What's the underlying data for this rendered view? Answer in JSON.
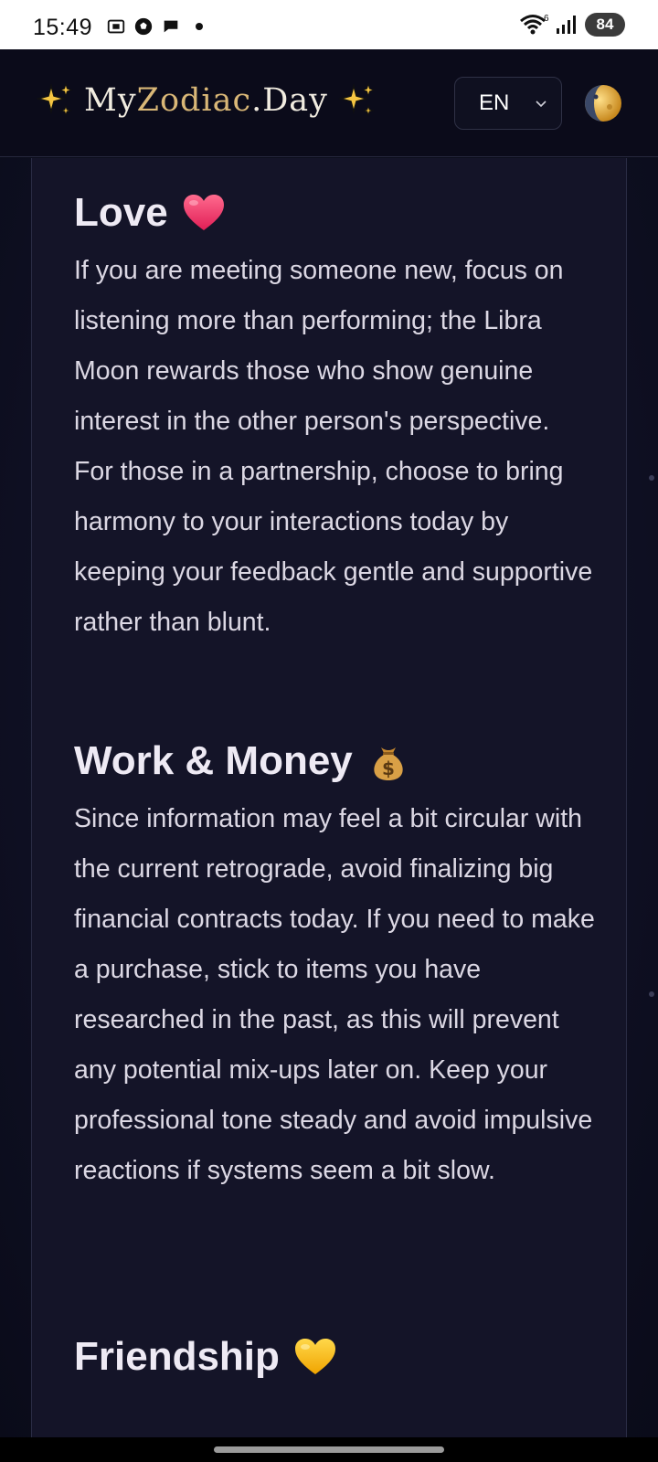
{
  "status_bar": {
    "time": "15:49",
    "left_icons": [
      "screenshot-icon",
      "soccer-ball-icon",
      "chat-bubble-icon",
      "dot-icon"
    ],
    "right_icons": [
      "wifi-icon",
      "signal-icon"
    ],
    "wifi_badge": "6",
    "battery": "84"
  },
  "header": {
    "brand": {
      "part1": "My",
      "part2": "Zodiac",
      "part3": ".Day"
    },
    "language": "EN",
    "theme_icon": "moon-phase-icon"
  },
  "sections": [
    {
      "title": "Love",
      "emoji": "heart-emoji",
      "body": "If you are meeting someone new, focus on listening more than performing; the Libra Moon rewards those who show genuine interest in the other person's perspective. For those in a partnership, choose to bring harmony to your interactions today by keeping your feedback gentle and supportive rather than blunt."
    },
    {
      "title": "Work & Money",
      "emoji": "money-bag-emoji",
      "body": "Since information may feel a bit circular with the current retrograde, avoid finalizing big financial contracts today. If you need to make a purchase, stick to items you have researched in the past, as this will prevent any potential mix-ups later on. Keep your professional tone steady and avoid impulsive reactions if systems seem a bit slow."
    },
    {
      "title": "Friendship",
      "emoji": "yellow-heart-emoji"
    }
  ],
  "colors": {
    "background": "#0c0d1c",
    "card": "#141428",
    "text": "#dcd8e4",
    "heading": "#eeeaf4",
    "brand_gold": "#d9b777"
  }
}
